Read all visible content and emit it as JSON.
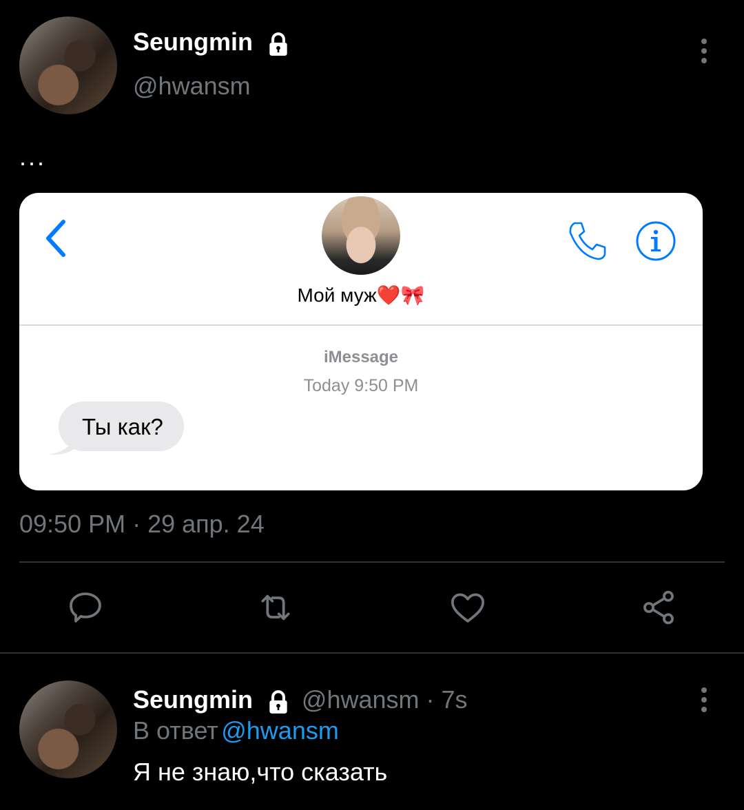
{
  "main_tweet": {
    "display_name": "Seungmin",
    "handle": "@hwansm",
    "text": "...",
    "meta": "09:50 PM · 29 апр. 24",
    "icons": {
      "lock": "lock-icon",
      "more": "more-vertical-icon",
      "reply": "reply-icon",
      "retweet": "retweet-icon",
      "like": "heart-icon",
      "share": "share-icon"
    }
  },
  "attached_screenshot": {
    "contact_name": "Мой муж❤️🎀",
    "service_label": "iMessage",
    "timestamp": "Today 9:50 PM",
    "messages": [
      {
        "text": "Ты как?",
        "direction": "incoming"
      }
    ],
    "icons": {
      "back": "chevron-left-icon",
      "call": "phone-icon",
      "info": "info-icon"
    },
    "accent_color": "#007aff"
  },
  "reply_tweet": {
    "display_name": "Seungmin",
    "handle_time": "@hwansm · 7s",
    "reply_prefix": "В ответ",
    "reply_to": "@hwansm",
    "text": "Я не знаю,что сказать"
  },
  "colors": {
    "background": "#000000",
    "secondary_text": "#71767b",
    "link": "#1d9bf0",
    "divider": "#2f3336"
  }
}
